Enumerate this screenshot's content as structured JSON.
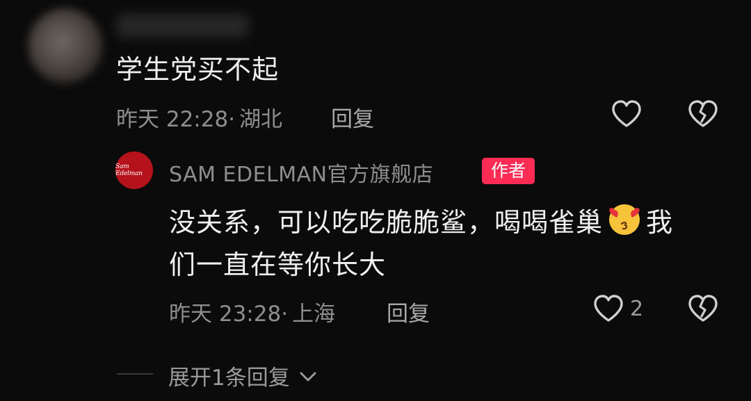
{
  "comment": {
    "text": "学生党买不起",
    "time": "昨天 22:28",
    "location": "湖北",
    "reply_label": "回复"
  },
  "reply": {
    "author": "SAM EDELMAN官方旗舰店",
    "badge": "作者",
    "avatar_text": "Sam Edelman",
    "text_line1_a": "没关系，可以吃吃脆脆鲨，喝喝雀巢",
    "text_line1_b": "我",
    "text_line2": "们一直在等你长大",
    "emoji": "smiling-face-with-heart-eyes",
    "time": "昨天 23:28",
    "location": "上海",
    "reply_label": "回复",
    "likes": "2"
  },
  "expand": {
    "label": "展开1条回复"
  },
  "colors": {
    "background": "#0b0b0b",
    "badge": "#fe2c55",
    "brand_avatar": "#b5121b",
    "meta_text": "#8e8e8e"
  },
  "icons": [
    "heart-outline-icon",
    "broken-heart-icon",
    "chevron-down-icon"
  ]
}
